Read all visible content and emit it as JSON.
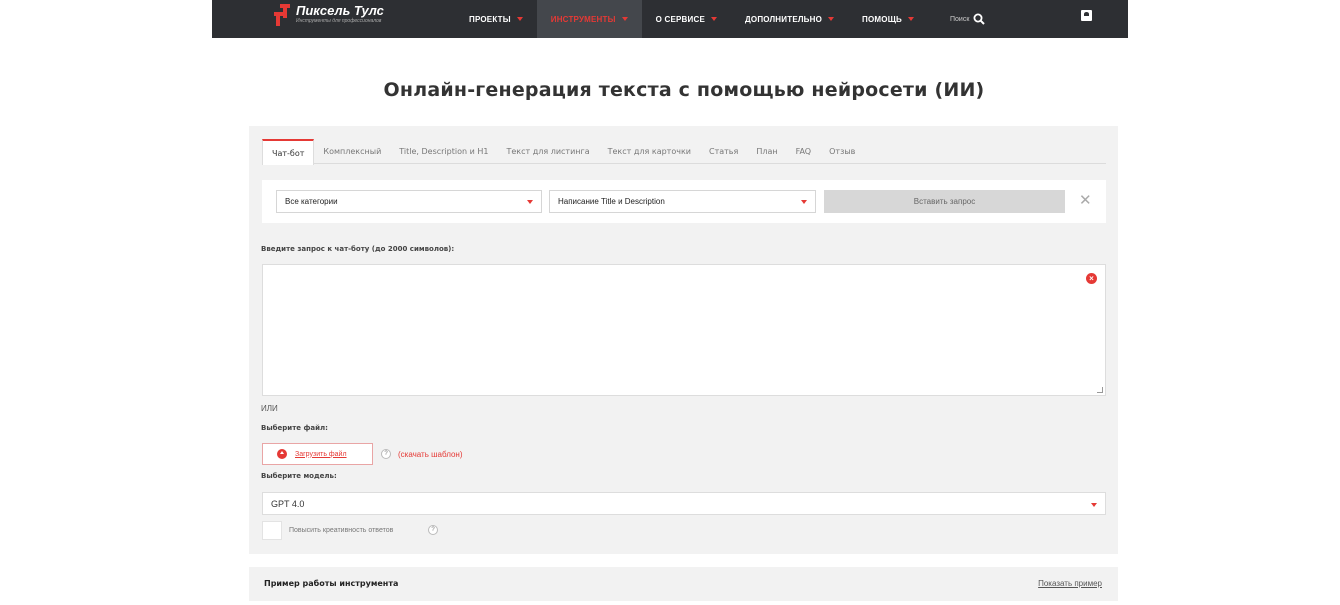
{
  "header": {
    "logo_title": "Пиксель Тулс",
    "logo_subtitle": "Инструменты для профессионалов",
    "nav": [
      {
        "label": "ПРОЕКТЫ"
      },
      {
        "label": "ИНСТРУМЕНТЫ",
        "active": true
      },
      {
        "label": "О СЕРВИСЕ"
      },
      {
        "label": "ДОПОЛНИТЕЛЬНО"
      },
      {
        "label": "ПОМОЩЬ"
      }
    ],
    "search_label": "Поиск"
  },
  "page_title": "Онлайн-генерация текста с помощью нейросети (ИИ)",
  "tabs": [
    {
      "label": "Чат-бот",
      "active": true
    },
    {
      "label": "Комплексный"
    },
    {
      "label": "Title, Description и H1"
    },
    {
      "label": "Текст для листинга"
    },
    {
      "label": "Текст для карточки"
    },
    {
      "label": "Статья"
    },
    {
      "label": "План"
    },
    {
      "label": "FAQ"
    },
    {
      "label": "Отзыв"
    }
  ],
  "form": {
    "category_select": "Все категории",
    "template_select": "Написание Title и Description",
    "insert_button": "Вставить запрос",
    "prompt_label": "Введите запрос к чат-боту (до 2000 символов):",
    "prompt_value": "",
    "or_text": "ИЛИ",
    "file_label": "Выберите файл:",
    "upload_button": "Загрузить файл",
    "download_template": "(скачать шаблон)",
    "model_label": "Выберите модель:",
    "model_value": "GPT 4.0",
    "creativity_label": "Повысить креативность ответов"
  },
  "example": {
    "title": "Пример работы инструмента",
    "show_link": "Показать пример"
  },
  "colors": {
    "accent": "#e53935",
    "topbar": "#2d2f33",
    "panel": "#f2f2f2"
  }
}
